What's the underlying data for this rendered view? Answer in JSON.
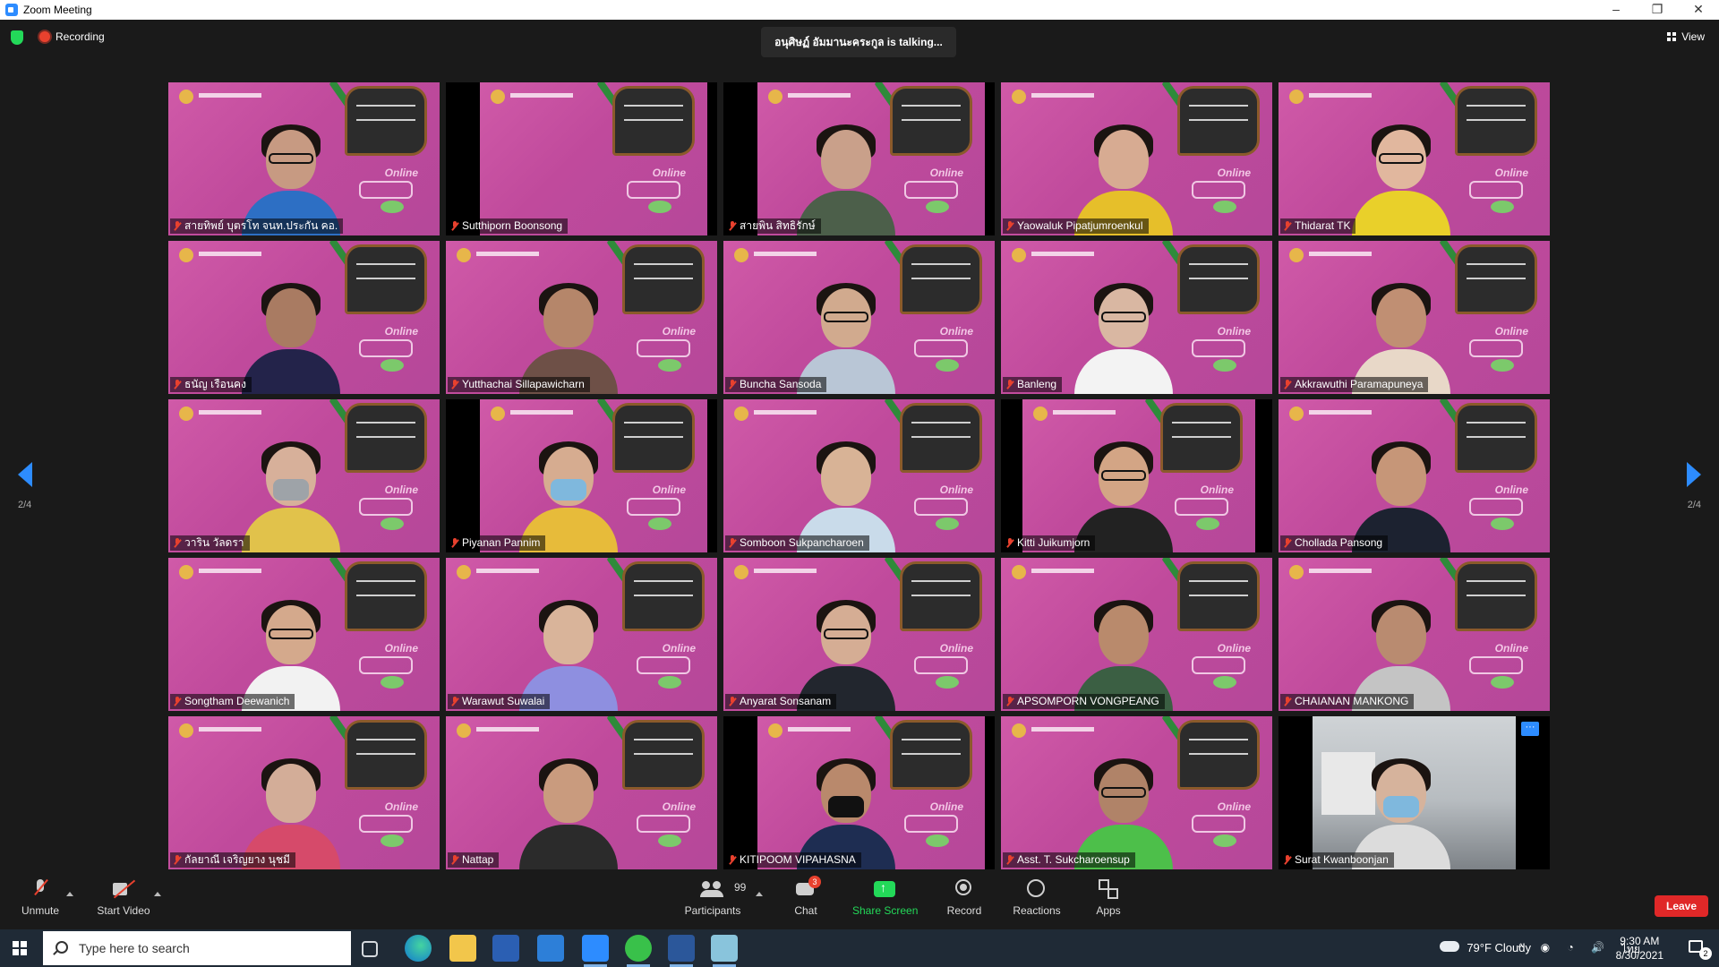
{
  "window": {
    "title": "Zoom Meeting"
  },
  "top": {
    "recording_label": "Recording",
    "talking": "อนุศิษฏ์ อัมมานะคระกูล is talking...",
    "view_label": "View",
    "page": "2/4"
  },
  "tiles": [
    {
      "name": "สายทิพย์ บุตรโท จนท.ประกัน คอ.",
      "skin": "#c79a82",
      "shirt": "#2d6fc4"
    },
    {
      "name": "Sutthiporn Boonsong",
      "skin": "",
      "shirt": ""
    },
    {
      "name": "สายพิน สิทธิรักษ์",
      "skin": "#c9a08a",
      "shirt": "#4c5f4a"
    },
    {
      "name": "Yaowaluk Pipatjumroenkul",
      "skin": "#d7ab92",
      "shirt": "#e6bf2a"
    },
    {
      "name": "Thidarat TK",
      "skin": "#e1b79e",
      "shirt": "#e9d02a"
    },
    {
      "name": "ธนัญ เรือนคง",
      "skin": "#a97b62",
      "shirt": "#23234a"
    },
    {
      "name": "Yutthachai Sillapawicharn",
      "skin": "#b5866a",
      "shirt": "#6e5047"
    },
    {
      "name": "Buncha Sansoda",
      "skin": "#d1aa8e",
      "shirt": "#b9c6d6"
    },
    {
      "name": "Banleng",
      "skin": "#d9b7a2",
      "shirt": "#f3f3f3"
    },
    {
      "name": "Akkrawuthi Paramapuneya",
      "skin": "#c08f73",
      "shirt": "#e8d8c8"
    },
    {
      "name": "วาริน วัลดรา",
      "skin": "#d7b09a",
      "shirt": "#e1c24b"
    },
    {
      "name": "Piyanan Pannim",
      "skin": "#d6ac90",
      "shirt": "#e7bb3a"
    },
    {
      "name": "Somboon Sukpancharoen",
      "skin": "#d8b396",
      "shirt": "#c9dbea"
    },
    {
      "name": "Kitti Juikumjorn",
      "skin": "#d3a585",
      "shirt": "#222222"
    },
    {
      "name": "Chollada Pansong",
      "skin": "#c69678",
      "shirt": "#1c2230"
    },
    {
      "name": "Songtham Deewanich",
      "skin": "#d4a98c",
      "shirt": "#f2f2f2"
    },
    {
      "name": "Warawut Suwalai",
      "skin": "#d9b49a",
      "shirt": "#8e8fe0"
    },
    {
      "name": "Anyarat Sonsanam",
      "skin": "#d5ad94",
      "shirt": "#22262e"
    },
    {
      "name": "APSOMPORN VONGPEANG",
      "skin": "#b98a6c",
      "shirt": "#3b5f43"
    },
    {
      "name": "CHAIANAN MANKONG",
      "skin": "#b98b70",
      "shirt": "#c4c4c4"
    },
    {
      "name": "กัลยาณี เจริญยาง นุชมี",
      "skin": "#d3ad98",
      "shirt": "#d64a6a"
    },
    {
      "name": "Nattap",
      "skin": "#c99b7e",
      "shirt": "#2b2b2b"
    },
    {
      "name": "KITIPOOM VIPAHASNA",
      "skin": "#b9896c",
      "shirt": "#1e2d52"
    },
    {
      "name": "Asst. T. Sukcharoensup",
      "skin": "#b08368",
      "shirt": "#4dbf4a"
    },
    {
      "name": "Surat Kwanboonjan",
      "skin": "#d6b39c",
      "shirt": "#dcdcdc"
    }
  ],
  "toolbar": {
    "unmute": "Unmute",
    "start_video": "Start Video",
    "participants": "Participants",
    "participants_count": "99",
    "chat": "Chat",
    "chat_badge": "3",
    "share": "Share Screen",
    "record": "Record",
    "reactions": "Reactions",
    "apps": "Apps",
    "leave": "Leave"
  },
  "taskbar": {
    "search_placeholder": "Type here to search",
    "weather": "79°F  Cloudy",
    "lang": "ไทย",
    "time": "9:30 AM",
    "date": "8/30/2021",
    "notifications": "2"
  }
}
